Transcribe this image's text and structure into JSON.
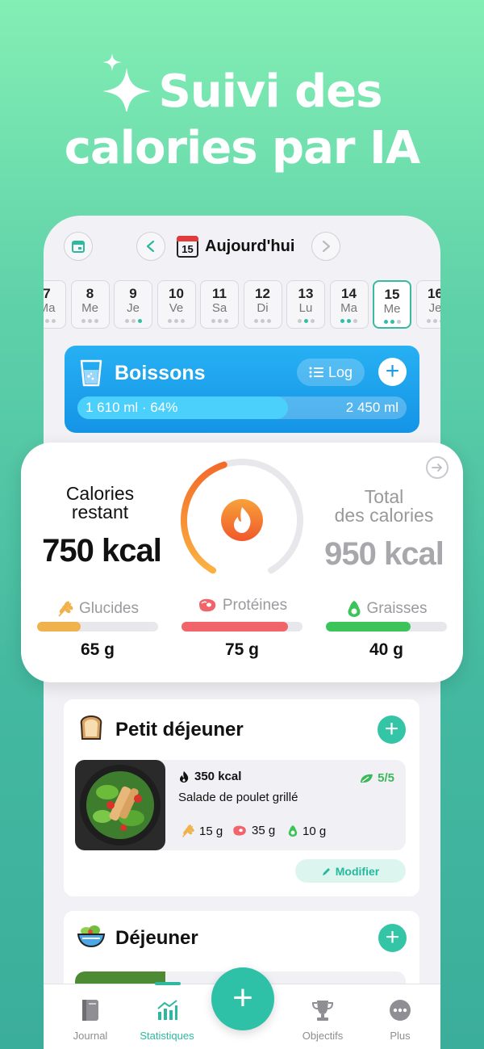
{
  "headline": {
    "line1": "Suivi des",
    "line2": "calories par IA"
  },
  "header": {
    "date_label": "Aujourd'hui",
    "calendar_day": "15"
  },
  "days": [
    {
      "num": "7",
      "wd": "Ma",
      "dots": [
        0,
        0,
        0
      ]
    },
    {
      "num": "8",
      "wd": "Me",
      "dots": [
        0,
        0,
        0
      ]
    },
    {
      "num": "9",
      "wd": "Je",
      "dots": [
        0,
        0,
        1
      ]
    },
    {
      "num": "10",
      "wd": "Ve",
      "dots": [
        0,
        0,
        0
      ]
    },
    {
      "num": "11",
      "wd": "Sa",
      "dots": [
        0,
        0,
        0
      ]
    },
    {
      "num": "12",
      "wd": "Di",
      "dots": [
        0,
        0,
        0
      ]
    },
    {
      "num": "13",
      "wd": "Lu",
      "dots": [
        0,
        1,
        0
      ]
    },
    {
      "num": "14",
      "wd": "Ma",
      "dots": [
        1,
        1,
        0
      ]
    },
    {
      "num": "15",
      "wd": "Me",
      "dots": [
        1,
        1,
        0
      ],
      "selected": true
    },
    {
      "num": "16",
      "wd": "Je",
      "dots": [
        0,
        0,
        0
      ]
    }
  ],
  "drinks": {
    "title": "Boissons",
    "log_label": "Log",
    "progress_text": "1 610 ml · 64%",
    "goal_text": "2 450 ml",
    "progress_fraction": 0.64
  },
  "calories": {
    "remaining_label_1": "Calories",
    "remaining_label_2": "restant",
    "remaining_value": "750 kcal",
    "total_label_1": "Total",
    "total_label_2": "des calories",
    "total_value": "950 kcal",
    "ring_fraction": 0.44
  },
  "macros": [
    {
      "label": "Glucides",
      "value": "65 g",
      "fraction": 0.36,
      "color": "#f0b24c"
    },
    {
      "label": "Protéines",
      "value": "75 g",
      "fraction": 0.88,
      "color": "#f0646a"
    },
    {
      "label": "Graisses",
      "value": "40 g",
      "fraction": 0.7,
      "color": "#3cc45a"
    }
  ],
  "breakfast": {
    "title": "Petit déjeuner",
    "kcal": "350 kcal",
    "score": "5/5",
    "name": "Salade de poulet grillé",
    "carbs": "15 g",
    "protein": "35 g",
    "fat": "10 g",
    "edit_label": "Modifier"
  },
  "lunch": {
    "title": "Déjeuner"
  },
  "tabs": [
    {
      "label": "Journal",
      "icon": "journal-icon"
    },
    {
      "label": "Statistiques",
      "icon": "stats-icon",
      "active": true
    },
    {
      "label": "Objectifs",
      "icon": "trophy-icon"
    },
    {
      "label": "Plus",
      "icon": "more-icon"
    }
  ],
  "colors": {
    "accent": "#2eb89f",
    "drinks": "#1a9be8",
    "ring": "#f7942d"
  }
}
